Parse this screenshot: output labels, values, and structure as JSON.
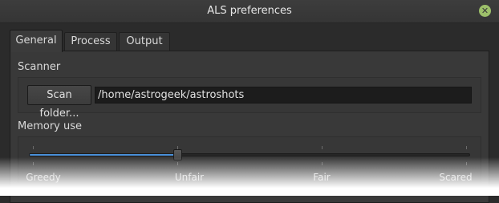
{
  "window": {
    "title": "ALS preferences",
    "close_icon": "close-icon",
    "close_color": "#9dc06a"
  },
  "tabs": [
    {
      "label": "General",
      "active": true
    },
    {
      "label": "Process",
      "active": false
    },
    {
      "label": "Output",
      "active": false
    }
  ],
  "scanner": {
    "label": "Scanner",
    "button_label": "Scan folder...",
    "path_value": "/home/astrogeek/astroshots"
  },
  "memory": {
    "label": "Memory use",
    "level_fraction": 0.336,
    "accent": "#4a90d9",
    "ticks": [
      "Greedy",
      "Unfair",
      "Fair",
      "Scared"
    ]
  }
}
